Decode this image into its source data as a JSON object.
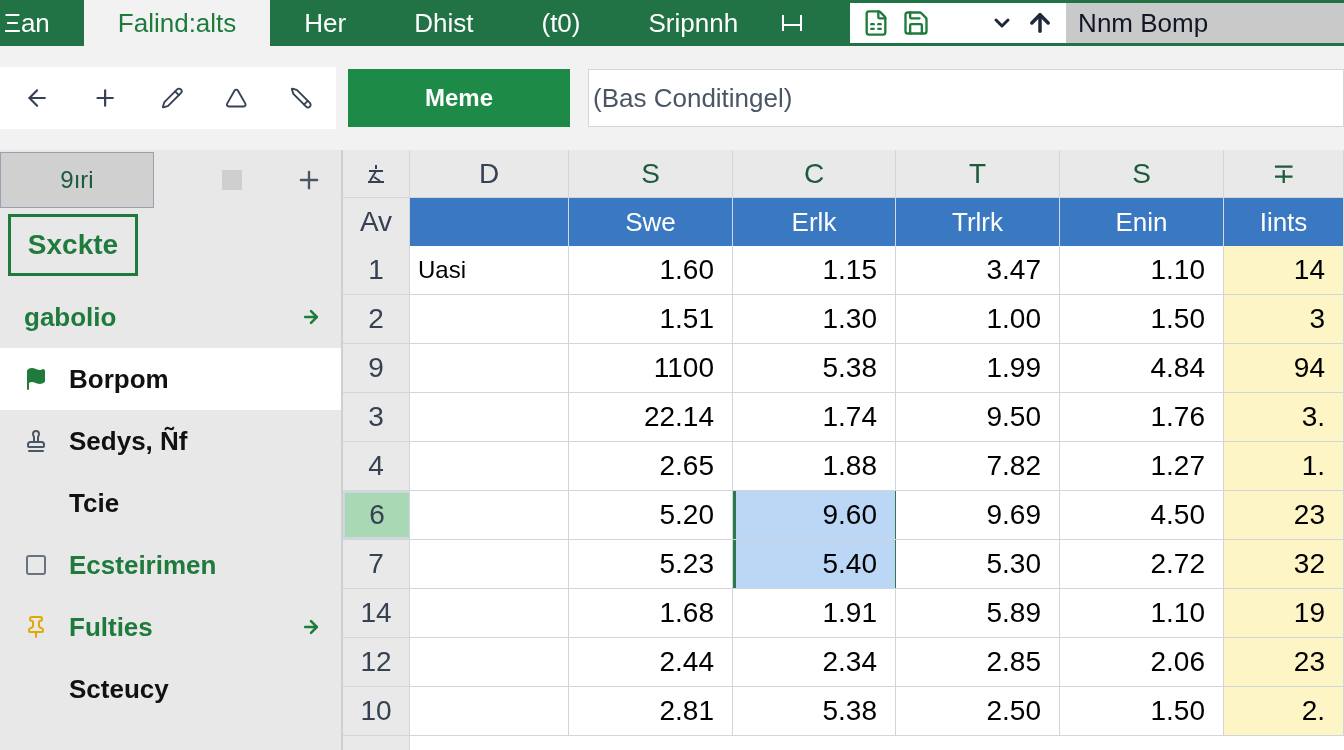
{
  "menu_tabs": [
    {
      "label": "Ξan",
      "selected": false
    },
    {
      "label": "Falind:alts",
      "selected": true
    },
    {
      "label": "Her",
      "selected": false
    },
    {
      "label": "Dhist",
      "selected": false
    },
    {
      "label": "(t0)",
      "selected": false
    },
    {
      "label": "Sripnnh",
      "selected": false
    }
  ],
  "account": {
    "label": "Nnm Bomp"
  },
  "toolbar": {
    "button": "Meme",
    "formula": "(Bas Conditingel)"
  },
  "sidebar": {
    "tab": "9ıri",
    "section": "Sxckte",
    "items": [
      {
        "label": "ɡabolio",
        "kind": "plain",
        "arrow": true,
        "selected": false,
        "color": "#1e7b3c"
      },
      {
        "label": "Borpom",
        "kind": "flag",
        "arrow": false,
        "selected": true,
        "color": "#111111"
      },
      {
        "label": "Sedys, Ñf",
        "kind": "stamp",
        "arrow": false,
        "selected": false,
        "color": "#111111"
      },
      {
        "label": "Tcie",
        "kind": "plain",
        "arrow": false,
        "selected": false,
        "color": "#111111"
      },
      {
        "label": "Ecsteirimen",
        "kind": "box",
        "arrow": false,
        "selected": false,
        "color": "#1e7b3c"
      },
      {
        "label": "Fulties",
        "kind": "pin",
        "arrow": true,
        "selected": false,
        "color": "#1e7b3c"
      },
      {
        "label": "Scteucy",
        "kind": "plain",
        "arrow": false,
        "selected": false,
        "color": "#111111"
      }
    ]
  },
  "table": {
    "corner_label": "Av",
    "columns": [
      {
        "letter": "D",
        "shaded": false
      },
      {
        "letter": "S",
        "heading": "Swe",
        "shaded": false
      },
      {
        "letter": "C",
        "heading": "Erlk",
        "shaded": false
      },
      {
        "letter": "T",
        "heading": "Trlrk",
        "shaded": false
      },
      {
        "letter": "S",
        "heading": "Enin",
        "shaded": false
      },
      {
        "letter": "∓",
        "heading": "Iints",
        "shaded": true
      }
    ],
    "rows": [
      {
        "header": "1",
        "selected": false,
        "cells": [
          {
            "text": "Uasi",
            "selected": false
          },
          {
            "text": "1.60",
            "selected": false
          },
          {
            "text": "1.15",
            "selected": false
          },
          {
            "text": "3.47",
            "selected": false
          },
          {
            "text": "1.10",
            "selected": false
          },
          {
            "text": "14",
            "selected": false
          }
        ]
      },
      {
        "header": "2",
        "selected": false,
        "cells": [
          {
            "selected": false
          },
          {
            "text": "1.51",
            "selected": false
          },
          {
            "text": "1.30",
            "selected": false
          },
          {
            "text": "1.00",
            "selected": false
          },
          {
            "text": "1.50",
            "selected": false
          },
          {
            "text": "3",
            "selected": false
          }
        ]
      },
      {
        "header": "9",
        "selected": false,
        "cells": [
          {
            "selected": false
          },
          {
            "text": "1100",
            "selected": false
          },
          {
            "text": "5.38",
            "selected": false
          },
          {
            "text": "1.99",
            "selected": false
          },
          {
            "text": "4.84",
            "selected": false
          },
          {
            "text": "94",
            "selected": false
          }
        ]
      },
      {
        "header": "3",
        "selected": false,
        "cells": [
          {
            "selected": false
          },
          {
            "text": "22.14",
            "selected": false
          },
          {
            "text": "1.74",
            "selected": false
          },
          {
            "text": "9.50",
            "selected": false
          },
          {
            "text": "1.76",
            "selected": false
          },
          {
            "text": "3.",
            "selected": false
          }
        ]
      },
      {
        "header": "4",
        "selected": false,
        "cells": [
          {
            "selected": false
          },
          {
            "text": "2.65",
            "selected": false
          },
          {
            "text": "1.88",
            "selected": false
          },
          {
            "text": "7.82",
            "selected": false
          },
          {
            "text": "1.27",
            "selected": false
          },
          {
            "text": "1.",
            "selected": false
          }
        ]
      },
      {
        "header": "6",
        "selected": true,
        "cells": [
          {
            "selected": false
          },
          {
            "text": "5.20",
            "selected": false
          },
          {
            "text": "9.60",
            "selected": true
          },
          {
            "text": "9.69",
            "selected": false
          },
          {
            "text": "4.50",
            "selected": false
          },
          {
            "text": "23",
            "selected": false
          }
        ]
      },
      {
        "header": "7",
        "selected": false,
        "cells": [
          {
            "selected": false
          },
          {
            "text": "5.23",
            "selected": false
          },
          {
            "text": "5.40",
            "selected": true
          },
          {
            "text": "5.30",
            "selected": false
          },
          {
            "text": "2.72",
            "selected": false
          },
          {
            "text": "32",
            "selected": false
          }
        ]
      },
      {
        "header": "14",
        "selected": false,
        "cells": [
          {
            "selected": false
          },
          {
            "text": "1.68",
            "selected": false
          },
          {
            "text": "1.91",
            "selected": false
          },
          {
            "text": "5.89",
            "selected": false
          },
          {
            "text": "1.10",
            "selected": false
          },
          {
            "text": "19",
            "selected": false
          }
        ]
      },
      {
        "header": "12",
        "selected": false,
        "cells": [
          {
            "selected": false
          },
          {
            "text": "2.44",
            "selected": false
          },
          {
            "text": "2.34",
            "selected": false
          },
          {
            "text": "2.85",
            "selected": false
          },
          {
            "text": "2.06",
            "selected": false
          },
          {
            "text": "23",
            "selected": false
          }
        ]
      },
      {
        "header": "10",
        "selected": false,
        "cells": [
          {
            "selected": false
          },
          {
            "text": "2.81",
            "selected": false
          },
          {
            "text": "5.38",
            "selected": false
          },
          {
            "text": "2.50",
            "selected": false
          },
          {
            "text": "1.50",
            "selected": false
          },
          {
            "text": "2.",
            "selected": false
          }
        ]
      }
    ]
  }
}
